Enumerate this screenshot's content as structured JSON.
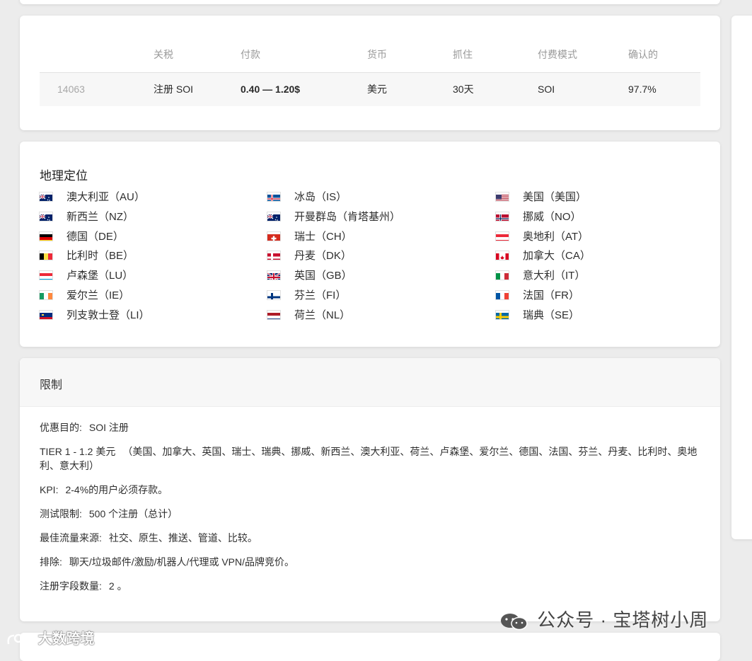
{
  "payout_table": {
    "headers": {
      "id": "",
      "tax": "关税",
      "payout": "付款",
      "currency": "货币",
      "capture": "抓住",
      "model": "付费模式",
      "confirmed": "确认的"
    },
    "row": {
      "id": "14063",
      "tax": "注册 SOI",
      "payout": "0.40 — 1.20$",
      "currency": "美元",
      "capture": "30天",
      "model": "SOI",
      "confirmed": "97.7%"
    }
  },
  "geo": {
    "title": "地理定位",
    "columns": [
      [
        {
          "label": "澳大利亚（AU）",
          "flag": "au-flag-icon"
        },
        {
          "label": "新西兰（NZ）",
          "flag": "nz-flag-icon"
        },
        {
          "label": "德国（DE）",
          "flag": "de-flag-icon"
        },
        {
          "label": "比利时（BE）",
          "flag": "be-flag-icon"
        },
        {
          "label": "卢森堡（LU）",
          "flag": "lu-flag-icon"
        },
        {
          "label": "爱尔兰（IE）",
          "flag": "ie-flag-icon"
        },
        {
          "label": "列支敦士登（LI）",
          "flag": "li-flag-icon"
        }
      ],
      [
        {
          "label": "冰岛（IS）",
          "flag": "is-flag-icon"
        },
        {
          "label": "开曼群岛（肯塔基州）",
          "flag": "ky-flag-icon"
        },
        {
          "label": "瑞士（CH）",
          "flag": "ch-flag-icon"
        },
        {
          "label": "丹麦（DK）",
          "flag": "dk-flag-icon"
        },
        {
          "label": "英国（GB）",
          "flag": "gb-flag-icon"
        },
        {
          "label": "芬兰（FI）",
          "flag": "fi-flag-icon"
        },
        {
          "label": "荷兰（NL）",
          "flag": "nl-flag-icon"
        }
      ],
      [
        {
          "label": "美国（美国）",
          "flag": "us-flag-icon"
        },
        {
          "label": "挪威（NO）",
          "flag": "no-flag-icon"
        },
        {
          "label": "奥地利（AT）",
          "flag": "at-flag-icon"
        },
        {
          "label": "加拿大（CA）",
          "flag": "ca-flag-icon"
        },
        {
          "label": "意大利（IT）",
          "flag": "it-flag-icon"
        },
        {
          "label": "法国（FR）",
          "flag": "fr-flag-icon"
        },
        {
          "label": "瑞典（SE）",
          "flag": "se-flag-icon"
        }
      ]
    ]
  },
  "restrictions": {
    "title": "限制",
    "lines": [
      {
        "key": "优惠目的:",
        "value": "SOI 注册"
      },
      {
        "key": "TIER 1 - 1.2 美元",
        "value": "（美国、加拿大、英国、瑞士、瑞典、挪威、新西兰、澳大利亚、荷兰、卢森堡、爱尔兰、德国、法国、芬兰、丹麦、比利时、奥地利、意大利）"
      },
      {
        "key": "KPI:",
        "value": "2-4%的用户必须存款。"
      },
      {
        "key": "测试限制:",
        "value": "500 个注册（总计）"
      },
      {
        "key": "最佳流量来源:",
        "value": "社交、原生、推送、管道、比较。"
      },
      {
        "key": "排除:",
        "value": "聊天/垃圾邮件/激励/机器人/代理或 VPN/品牌竞价。"
      },
      {
        "key": "注册字段数量:",
        "value": "2 。"
      }
    ]
  },
  "watermarks": {
    "wechat": "公众号 · 宝塔树小周",
    "brand": "大数跨境"
  }
}
